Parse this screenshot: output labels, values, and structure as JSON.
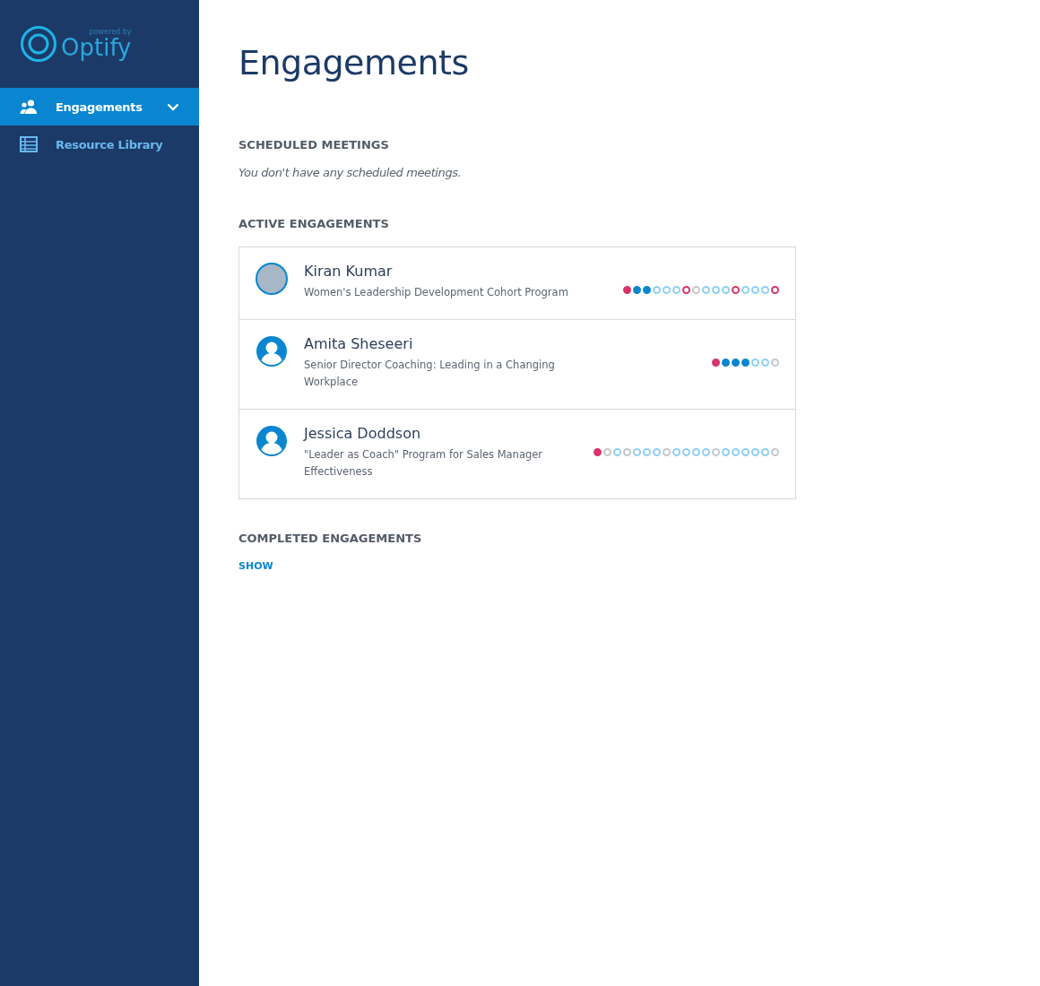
{
  "sidebar": {
    "logo": {
      "tagline": "powered by",
      "name": "Optify"
    },
    "items": [
      {
        "label": "Engagements",
        "kind": "people",
        "selected": true,
        "expandable": true
      },
      {
        "label": "Resource Library",
        "kind": "list",
        "selected": false,
        "expandable": false
      }
    ]
  },
  "page": {
    "title": "Engagements"
  },
  "scheduled": {
    "heading": "SCHEDULED MEETINGS",
    "empty_text": "You don't have any scheduled meetings."
  },
  "active": {
    "heading": "ACTIVE ENGAGEMENTS",
    "engagements": [
      {
        "name": "Kiran Kumar",
        "program": "Women's Leadership Development Cohort Program",
        "kind": "photo",
        "sessions": [
          {
            "color": "#d8336a",
            "filled": true
          },
          {
            "color": "#0a86d0",
            "filled": true
          },
          {
            "color": "#0a86d0",
            "filled": true
          },
          {
            "color": "#8fd0f5",
            "filled": false
          },
          {
            "color": "#8fd0f5",
            "filled": false
          },
          {
            "color": "#8fd0f5",
            "filled": false
          },
          {
            "color": "#d8336a",
            "filled": false
          },
          {
            "color": "#c4c8cf",
            "filled": false
          },
          {
            "color": "#8fd0f5",
            "filled": false
          },
          {
            "color": "#8fd0f5",
            "filled": false
          },
          {
            "color": "#8fd0f5",
            "filled": false
          },
          {
            "color": "#d8336a",
            "filled": false
          },
          {
            "color": "#8fd0f5",
            "filled": false
          },
          {
            "color": "#8fd0f5",
            "filled": false
          },
          {
            "color": "#8fd0f5",
            "filled": false
          },
          {
            "color": "#d8336a",
            "filled": false
          }
        ]
      },
      {
        "name": "Amita Sheseeri",
        "program": "Senior Director Coaching: Leading in a Changing Workplace",
        "kind": "silhouette",
        "sessions": [
          {
            "color": "#d8336a",
            "filled": true
          },
          {
            "color": "#0a86d0",
            "filled": true
          },
          {
            "color": "#0a86d0",
            "filled": true
          },
          {
            "color": "#0a86d0",
            "filled": true
          },
          {
            "color": "#8fd0f5",
            "filled": false
          },
          {
            "color": "#8fd0f5",
            "filled": false
          },
          {
            "color": "#c4c8cf",
            "filled": false
          }
        ]
      },
      {
        "name": "Jessica Doddson",
        "program": "\"Leader as Coach\" Program for Sales Manager Effectiveness",
        "kind": "silhouette",
        "sessions": [
          {
            "color": "#d8336a",
            "filled": true
          },
          {
            "color": "#c4c8cf",
            "filled": false
          },
          {
            "color": "#8fd0f5",
            "filled": false
          },
          {
            "color": "#c4c8cf",
            "filled": false
          },
          {
            "color": "#8fd0f5",
            "filled": false
          },
          {
            "color": "#8fd0f5",
            "filled": false
          },
          {
            "color": "#8fd0f5",
            "filled": false
          },
          {
            "color": "#c4c8cf",
            "filled": false
          },
          {
            "color": "#8fd0f5",
            "filled": false
          },
          {
            "color": "#8fd0f5",
            "filled": false
          },
          {
            "color": "#8fd0f5",
            "filled": false
          },
          {
            "color": "#8fd0f5",
            "filled": false
          },
          {
            "color": "#c4c8cf",
            "filled": false
          },
          {
            "color": "#8fd0f5",
            "filled": false
          },
          {
            "color": "#8fd0f5",
            "filled": false
          },
          {
            "color": "#8fd0f5",
            "filled": false
          },
          {
            "color": "#8fd0f5",
            "filled": false
          },
          {
            "color": "#8fd0f5",
            "filled": false
          },
          {
            "color": "#c4c8cf",
            "filled": false
          }
        ]
      }
    ]
  },
  "completed": {
    "heading": "COMPLETED ENGAGEMENTS",
    "toggle": "SHOW"
  }
}
